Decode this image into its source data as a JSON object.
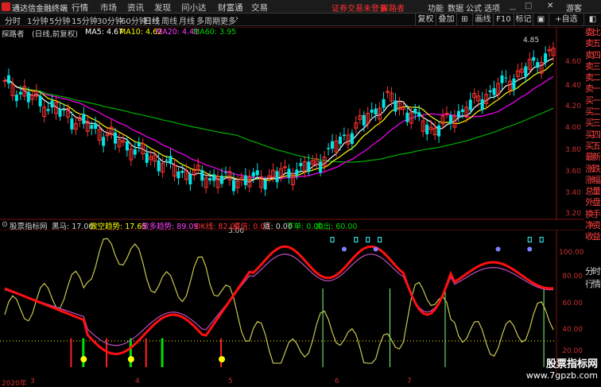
{
  "app": {
    "title": "通达信金融终端"
  },
  "menu": [
    "行情",
    "市场",
    "资讯",
    "发现",
    "问小达",
    "财富通",
    "交易"
  ],
  "notice": {
    "login": "证券交易未登录",
    "explorer": "探路者"
  },
  "right_menu": [
    "功能",
    "数据",
    "公式",
    "选项",
    "游客"
  ],
  "periods": [
    "分时",
    "1分钟",
    "5分钟",
    "15分钟",
    "30分钟",
    "60分钟",
    "日线",
    "周线",
    "月线",
    "多周期",
    "更多"
  ],
  "active_period": "日线",
  "toolbar_right": [
    "复权",
    "叠加",
    "画线",
    "F10",
    "标记",
    "+自选"
  ],
  "stock": {
    "name": "探路者",
    "period_label": "(日线,前复权)"
  },
  "ma": {
    "ma5": "MA5: 4.67",
    "ma10": "MA10: 4.62",
    "ma20": "MA20: 4.41",
    "ma60": "MA60: 3.95",
    "colors": {
      "ma5": "#ffffff",
      "ma10": "#ffff00",
      "ma20": "#ff00ff",
      "ma60": "#00c000"
    }
  },
  "price_axis": [
    "4.60",
    "4.40",
    "4.20",
    "4.00",
    "3.80",
    "3.60",
    "3.40",
    "3.20"
  ],
  "price_labels": {
    "high": "4.85",
    "low": "3.06"
  },
  "side_tabs": [
    "委比",
    "卖五",
    "卖四",
    "卖三",
    "卖二",
    "卖一",
    "买一",
    "买二",
    "买三",
    "买四",
    "买五",
    "最新",
    "涨跌",
    "涨幅",
    "总量",
    "外盘",
    "换手",
    "净资",
    "收益"
  ],
  "side_tabs2": [
    "分时",
    "行情"
  ],
  "sub": {
    "name": "股票指标网",
    "heima": "黑马: 17.00",
    "zuokong": "做空趋势: 17.65",
    "zuoduo": "做多趋势: 89.09",
    "okline": "OK线: 82.00",
    "maixin": "买信: 0.00",
    "di": "底: 0.00",
    "xiadan": "下单: 0.00",
    "maichu": "卖出: 60.00"
  },
  "sub_axis": [
    "100.00",
    "80.00",
    "60.00",
    "40.00",
    "20.00"
  ],
  "dates": [
    "2020年",
    "3",
    "4",
    "5",
    "6",
    "7"
  ],
  "watermark": {
    "line1": "股票指标网",
    "line2": "www.7gpzb.com"
  }
}
